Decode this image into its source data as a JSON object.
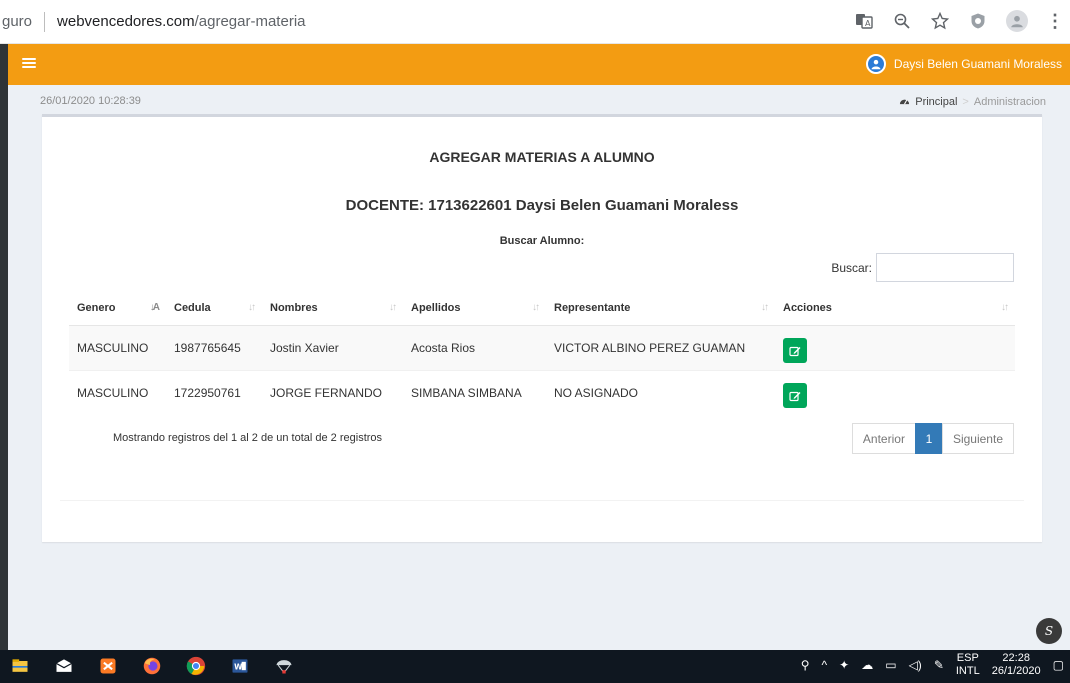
{
  "browser": {
    "url_prefix": "guro",
    "url_domain": "webvencedores.com",
    "url_path": "/agregar-materia"
  },
  "header": {
    "user_name": "Daysi Belen Guamani Moraless",
    "accent": "#f39c12"
  },
  "topbar": {
    "datetime": "26/01/2020 10:28:39",
    "breadcrumb": {
      "home": "Principal",
      "current": "Administracion"
    }
  },
  "main": {
    "title": "AGREGAR MATERIAS A ALUMNO",
    "docente": "DOCENTE: 1713622601 Daysi Belen Guamani Moraless",
    "buscar_alumno": "Buscar Alumno:",
    "search_label": "Buscar:",
    "search_value": "",
    "columns": [
      "Genero",
      "Cedula",
      "Nombres",
      "Apellidos",
      "Representante",
      "Acciones"
    ],
    "rows": [
      {
        "genero": "MASCULINO",
        "cedula": "1987765645",
        "nombres": "Jostin Xavier",
        "apellidos": "Acosta Rios",
        "representante": "VICTOR ALBINO PEREZ GUAMAN"
      },
      {
        "genero": "MASCULINO",
        "cedula": "1722950761",
        "nombres": "JORGE FERNANDO",
        "apellidos": "SIMBANA SIMBANA",
        "representante": "NO ASIGNADO"
      }
    ],
    "info": "Mostrando registros del 1 al 2 de un total de 2 registros",
    "pagination": {
      "prev": "Anterior",
      "current": "1",
      "next": "Siguiente"
    },
    "action_color": "#00a65a"
  },
  "taskbar": {
    "lang_top": "ESP",
    "lang_bottom": "INTL",
    "time": "22:28",
    "date": "26/1/2020"
  }
}
